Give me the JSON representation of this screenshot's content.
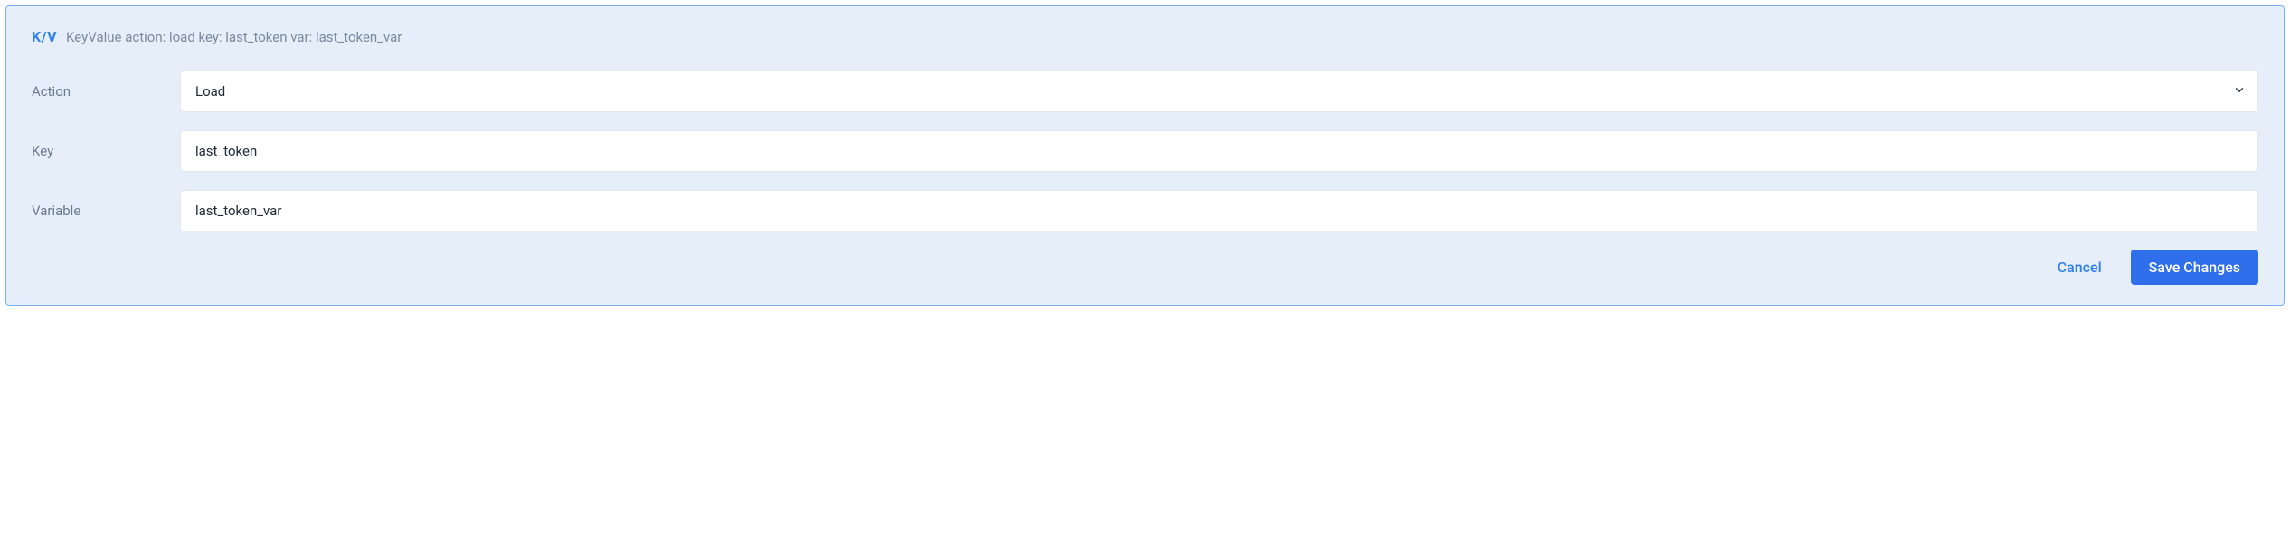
{
  "header": {
    "badge": "K/V",
    "description": "KeyValue action: load key: last_token var: last_token_var"
  },
  "form": {
    "action": {
      "label": "Action",
      "value": "Load"
    },
    "key": {
      "label": "Key",
      "value": "last_token"
    },
    "variable": {
      "label": "Variable",
      "value": "last_token_var"
    }
  },
  "buttons": {
    "cancel": "Cancel",
    "save": "Save Changes"
  }
}
